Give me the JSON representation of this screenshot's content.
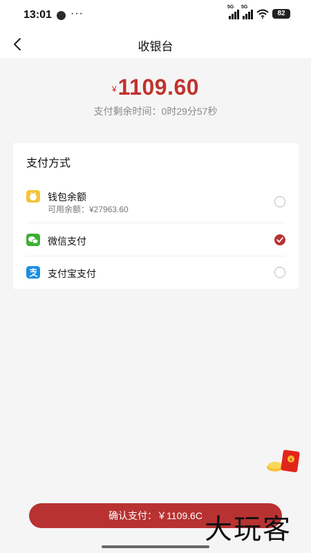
{
  "status_bar": {
    "time": "13:01",
    "more": "···",
    "net1": "5G",
    "net2": "5G",
    "battery": "82"
  },
  "nav": {
    "back_icon": "chevron-left-icon",
    "title": "收银台"
  },
  "amount": {
    "currency": "¥",
    "value": "1109.60",
    "color": "#c0332e"
  },
  "countdown": "支付剩余时间：0时29分57秒",
  "payment": {
    "section_title": "支付方式",
    "options": [
      {
        "icon": "wallet-icon",
        "label": "钱包余额",
        "sub": "可用余额：¥27963.60",
        "selected": false
      },
      {
        "icon": "wechat-icon",
        "label": "微信支付",
        "sub": "",
        "selected": true
      },
      {
        "icon": "alipay-icon",
        "label": "支付宝支付",
        "sub": "",
        "selected": false
      }
    ]
  },
  "confirm": {
    "label": "确认支付：￥1109.6C",
    "color": "#b83232"
  },
  "watermark": "大玩客",
  "floating": {
    "icon": "red-envelope-icon"
  }
}
